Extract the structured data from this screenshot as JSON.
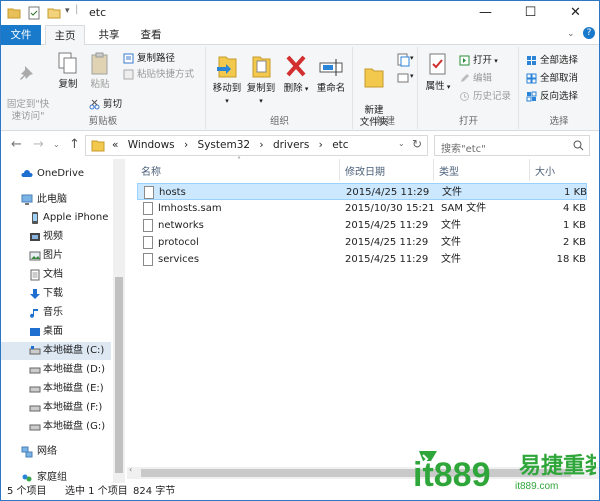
{
  "window": {
    "title": "etc",
    "minimize": "—",
    "maximize": "☐",
    "close": "✕"
  },
  "tabs": [
    {
      "label": "文件"
    },
    {
      "label": "主页"
    },
    {
      "label": "共享"
    },
    {
      "label": "查看"
    }
  ],
  "ribbon": {
    "clipboard": {
      "label": "剪贴板",
      "pin": "固定到\"快\n速访问\"",
      "copy": "复制",
      "paste": "粘贴",
      "copy_path": "复制路径",
      "paste_shortcut": "粘贴快捷方式",
      "cut": "剪切"
    },
    "organize": {
      "label": "组织",
      "move_to": "移动到",
      "copy_to": "复制到",
      "delete": "删除",
      "rename": "重命名"
    },
    "new": {
      "label": "新建",
      "new_folder": "新建\n文件夹"
    },
    "open": {
      "label": "打开",
      "properties": "属性",
      "open": "打开",
      "edit": "编辑",
      "history": "历史记录"
    },
    "select": {
      "label": "选择",
      "select_all": "全部选择",
      "select_none": "全部取消",
      "invert": "反向选择"
    }
  },
  "address": {
    "crumbs": [
      "«",
      "Windows",
      "›",
      "System32",
      "›",
      "drivers",
      "›",
      "etc"
    ],
    "search_placeholder": "搜索\"etc\""
  },
  "nav": {
    "onedrive": "OneDrive",
    "this_pc": "此电脑",
    "iphone": "Apple iPhone",
    "videos": "视频",
    "pictures": "图片",
    "documents": "文档",
    "downloads": "下载",
    "music": "音乐",
    "desktop": "桌面",
    "disk_c": "本地磁盘 (C:)",
    "disk_d": "本地磁盘 (D:)",
    "disk_e": "本地磁盘 (E:)",
    "disk_f": "本地磁盘 (F:)",
    "disk_g": "本地磁盘 (G:)",
    "network": "网络",
    "homegroup": "家庭组"
  },
  "columns": {
    "name": "名称",
    "modified": "修改日期",
    "type": "类型",
    "size": "大小"
  },
  "files": [
    {
      "name": "hosts",
      "modified": "2015/4/25 11:29",
      "type": "文件",
      "size": "1 KB"
    },
    {
      "name": "lmhosts.sam",
      "modified": "2015/10/30 15:21",
      "type": "SAM 文件",
      "size": "4 KB"
    },
    {
      "name": "networks",
      "modified": "2015/4/25 11:29",
      "type": "文件",
      "size": "1 KB"
    },
    {
      "name": "protocol",
      "modified": "2015/4/25 11:29",
      "type": "文件",
      "size": "2 KB"
    },
    {
      "name": "services",
      "modified": "2015/4/25 11:29",
      "type": "文件",
      "size": "18 KB"
    }
  ],
  "status": {
    "count": "5 个项目",
    "selected": "选中 1 个项目",
    "size": "824 字节"
  },
  "watermark": {
    "brand": "it889.com",
    "cn": "易捷重装"
  },
  "colors": {
    "accent": "#1979ca",
    "selection": "#cce8ff",
    "watermark_green": "#2fa63a"
  }
}
